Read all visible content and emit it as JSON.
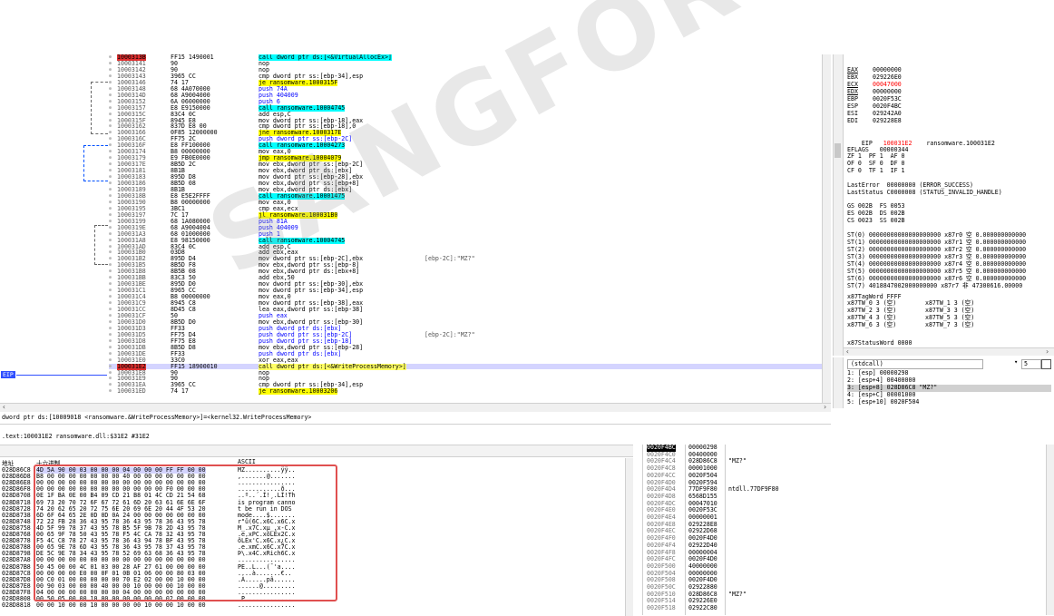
{
  "disasm": {
    "rows": [
      {
        "addr": "1000313B",
        "bytes": "FF15 1490001",
        "instr": "call dword ptr ds:[<&VirtualAllocEx>]",
        "comment": "",
        "kind": "call",
        "cur": false
      },
      {
        "addr": "10003141",
        "bytes": "90",
        "instr": "nop",
        "comment": "",
        "kind": "",
        "cur": false
      },
      {
        "addr": "10003142",
        "bytes": "90",
        "instr": "nop",
        "comment": "",
        "kind": "",
        "cur": false
      },
      {
        "addr": "10003143",
        "bytes": "3965 CC",
        "instr": "cmp dword ptr ss:[ebp-34],esp",
        "comment": "",
        "kind": "",
        "cur": false
      },
      {
        "addr": "10003146",
        "bytes": "74 17",
        "instr": "je ransomware.1000315F",
        "comment": "",
        "kind": "jmp",
        "cur": false
      },
      {
        "addr": "10003148",
        "bytes": "68 4A070000",
        "instr": "push 74A",
        "comment": "",
        "kind": "push",
        "cur": false
      },
      {
        "addr": "1000314D",
        "bytes": "68 A9004000",
        "instr": "push 404009",
        "comment": "",
        "kind": "push",
        "cur": false
      },
      {
        "addr": "10003152",
        "bytes": "6A 06000000",
        "instr": "push 6",
        "comment": "",
        "kind": "push",
        "cur": false
      },
      {
        "addr": "10003157",
        "bytes": "E8 E9150000",
        "instr": "call ransomware.10004745",
        "comment": "",
        "kind": "call",
        "cur": false
      },
      {
        "addr": "1000315C",
        "bytes": "83C4 0C",
        "instr": "add esp,C",
        "comment": "",
        "kind": "",
        "cur": false
      },
      {
        "addr": "1000315F",
        "bytes": "8945 E8",
        "instr": "mov dword ptr ss:[ebp-18],eax",
        "comment": "",
        "kind": "",
        "cur": false
      },
      {
        "addr": "10003162",
        "bytes": "837D E8 00",
        "instr": "cmp dword ptr ss:[ebp-18],0",
        "comment": "",
        "kind": "",
        "cur": false
      },
      {
        "addr": "10003166",
        "bytes": "0F85 12000000",
        "instr": "jne ransomware.1000317E",
        "comment": "",
        "kind": "jmp",
        "cur": false
      },
      {
        "addr": "1000316C",
        "bytes": "FF75 2C",
        "instr": "push dword ptr ss:[ebp-2C]",
        "comment": "",
        "kind": "push",
        "cur": false
      },
      {
        "addr": "1000316F",
        "bytes": "E8 FF100000",
        "instr": "call ransomware.10004273",
        "comment": "",
        "kind": "call",
        "cur": false
      },
      {
        "addr": "10003174",
        "bytes": "B8 00000000",
        "instr": "mov eax,0",
        "comment": "",
        "kind": "",
        "cur": false
      },
      {
        "addr": "10003179",
        "bytes": "E9 FB0E0000",
        "instr": "jmp ransomware.10004079",
        "comment": "",
        "kind": "jmp",
        "cur": false
      },
      {
        "addr": "1000317E",
        "bytes": "8B5D 2C",
        "instr": "mov ebx,dword ptr ss:[ebp-2C]",
        "comment": "",
        "kind": "",
        "cur": false
      },
      {
        "addr": "10003181",
        "bytes": "8B1B",
        "instr": "mov ebx,dword ptr ds:[ebx]",
        "comment": "",
        "kind": "",
        "cur": false
      },
      {
        "addr": "10003183",
        "bytes": "895D D8",
        "instr": "mov dword ptr ss:[ebp-28],ebx",
        "comment": "",
        "kind": "",
        "cur": false
      },
      {
        "addr": "10003186",
        "bytes": "8B5D 08",
        "instr": "mov ebx,dword ptr ss:[ebp+8]",
        "comment": "",
        "kind": "",
        "cur": false
      },
      {
        "addr": "10003189",
        "bytes": "8B1B",
        "instr": "mov ebx,dword ptr ds:[ebx]",
        "comment": "",
        "kind": "",
        "cur": false
      },
      {
        "addr": "1000318B",
        "bytes": "E8 E5E2FFFF",
        "instr": "call ransomware.10001475",
        "comment": "",
        "kind": "call",
        "cur": false
      },
      {
        "addr": "10003190",
        "bytes": "B8 00000000",
        "instr": "mov eax,0",
        "comment": "",
        "kind": "",
        "cur": false
      },
      {
        "addr": "10003195",
        "bytes": "3BC1",
        "instr": "cmp eax,ecx",
        "comment": "",
        "kind": "",
        "cur": false
      },
      {
        "addr": "10003197",
        "bytes": "7C 17",
        "instr": "jl ransomware.100031B0",
        "comment": "",
        "kind": "jmp",
        "cur": false
      },
      {
        "addr": "10003199",
        "bytes": "68 1A080000",
        "instr": "push 81A",
        "comment": "",
        "kind": "push",
        "cur": false
      },
      {
        "addr": "1000319E",
        "bytes": "68 A9004004",
        "instr": "push 404009",
        "comment": "",
        "kind": "push",
        "cur": false
      },
      {
        "addr": "100031A3",
        "bytes": "68 01000000",
        "instr": "push 1",
        "comment": "",
        "kind": "push",
        "cur": false
      },
      {
        "addr": "100031A8",
        "bytes": "E8 98150000",
        "instr": "call ransomware.10004745",
        "comment": "",
        "kind": "call",
        "cur": false
      },
      {
        "addr": "100031AD",
        "bytes": "83C4 0C",
        "instr": "add esp,C",
        "comment": "",
        "kind": "",
        "cur": false
      },
      {
        "addr": "100031B0",
        "bytes": "03D8",
        "instr": "add ebx,eax",
        "comment": "",
        "kind": "",
        "cur": false
      },
      {
        "addr": "100031B2",
        "bytes": "895D D4",
        "instr": "mov dword ptr ss:[ebp-2C],ebx",
        "comment": "[ebp-2C]:\"MZ?\"",
        "kind": "",
        "cur": false
      },
      {
        "addr": "100031B5",
        "bytes": "8B5D F8",
        "instr": "mov ebx,dword ptr ss:[ebp-8]",
        "comment": "",
        "kind": "",
        "cur": false
      },
      {
        "addr": "100031B8",
        "bytes": "8B5B 08",
        "instr": "mov ebx,dword ptr ds:[ebx+8]",
        "comment": "",
        "kind": "",
        "cur": false
      },
      {
        "addr": "100031BB",
        "bytes": "83C3 50",
        "instr": "add ebx,50",
        "comment": "",
        "kind": "",
        "cur": false
      },
      {
        "addr": "100031BE",
        "bytes": "895D D0",
        "instr": "mov dword ptr ss:[ebp-30],ebx",
        "comment": "",
        "kind": "",
        "cur": false
      },
      {
        "addr": "100031C1",
        "bytes": "8965 CC",
        "instr": "mov dword ptr ss:[ebp-34],esp",
        "comment": "",
        "kind": "",
        "cur": false
      },
      {
        "addr": "100031C4",
        "bytes": "B8 00000000",
        "instr": "mov eax,0",
        "comment": "",
        "kind": "",
        "cur": false
      },
      {
        "addr": "100031C9",
        "bytes": "8945 C8",
        "instr": "mov dword ptr ss:[ebp-38],eax",
        "comment": "",
        "kind": "",
        "cur": false
      },
      {
        "addr": "100031CC",
        "bytes": "8D45 C8",
        "instr": "lea eax,dword ptr ss:[ebp-38]",
        "comment": "",
        "kind": "",
        "cur": false
      },
      {
        "addr": "100031CF",
        "bytes": "50",
        "instr": "push eax",
        "comment": "",
        "kind": "push",
        "cur": false
      },
      {
        "addr": "100031D0",
        "bytes": "8B5D D0",
        "instr": "mov ebx,dword ptr ss:[ebp-30]",
        "comment": "",
        "kind": "",
        "cur": false
      },
      {
        "addr": "100031D3",
        "bytes": "FF33",
        "instr": "push dword ptr ds:[ebx]",
        "comment": "",
        "kind": "push",
        "cur": false
      },
      {
        "addr": "100031D5",
        "bytes": "FF75 D4",
        "instr": "push dword ptr ss:[ebp-2C]",
        "comment": "[ebp-2C]:\"MZ?\"",
        "kind": "push",
        "cur": false
      },
      {
        "addr": "100031D8",
        "bytes": "FF75 E8",
        "instr": "push dword ptr ss:[ebp-18]",
        "comment": "",
        "kind": "push",
        "cur": false
      },
      {
        "addr": "100031DB",
        "bytes": "8B5D D8",
        "instr": "mov ebx,dword ptr ss:[ebp-28]",
        "comment": "",
        "kind": "",
        "cur": false
      },
      {
        "addr": "100031DE",
        "bytes": "FF33",
        "instr": "push dword ptr ds:[ebx]",
        "comment": "",
        "kind": "push",
        "cur": false
      },
      {
        "addr": "100031E0",
        "bytes": "33C0",
        "instr": "xor eax,eax",
        "comment": "",
        "kind": "",
        "cur": false
      },
      {
        "addr": "100031E2",
        "bytes": "FF15 18900010",
        "instr": "call dword ptr ds:[<&WriteProcessMemory>]",
        "comment": "",
        "kind": "call",
        "cur": true
      },
      {
        "addr": "100031E8",
        "bytes": "90",
        "instr": "nop",
        "comment": "",
        "kind": "",
        "cur": false
      },
      {
        "addr": "100031E9",
        "bytes": "90",
        "instr": "nop",
        "comment": "",
        "kind": "",
        "cur": false
      },
      {
        "addr": "100031EA",
        "bytes": "3965 CC",
        "instr": "cmp dword ptr ss:[ebp-34],esp",
        "comment": "",
        "kind": "",
        "cur": false
      },
      {
        "addr": "100031ED",
        "bytes": "74 17",
        "instr": "je ransomware.10003206",
        "comment": "",
        "kind": "jmp",
        "cur": false
      }
    ],
    "eip_label": "EIP",
    "info_line": "dword ptr ds:[10009018 <ransomware.&WriteProcessMemory>]=<kernel32.WriteProcessMemory>",
    "section_line": ".text:100031E2 ransomware.dll:$31E2 #31E2"
  },
  "registers": {
    "general": [
      {
        "name": "EAX",
        "value": "00000000",
        "changed": false
      },
      {
        "name": "EBX",
        "value": "029226E0",
        "changed": false
      },
      {
        "name": "ECX",
        "value": "00047000",
        "changed": true
      },
      {
        "name": "EDX",
        "value": "00000000",
        "changed": false
      },
      {
        "name": "EBP",
        "value": "0020F53C",
        "changed": false
      },
      {
        "name": "ESP",
        "value": "0020F4BC",
        "changed": false
      },
      {
        "name": "ESI",
        "value": "029242A0",
        "changed": false
      },
      {
        "name": "EDI",
        "value": "029228E8",
        "changed": false
      }
    ],
    "eip_name": "EIP",
    "eip_value": "100031E2",
    "eip_comment": "ransomware.100031E2",
    "eflags": "EFLAGS   00000344",
    "flags_lines": [
      "ZF 1  PF 1  AF 0",
      "OF 0  SF 0  DF 0",
      "CF 0  TF 1  IF 1"
    ],
    "last_error": "LastError  00000000 (ERROR_SUCCESS)",
    "last_status": "LastStatus C0000008 (STATUS_INVALID_HANDLE)",
    "segs": [
      "GS 002B  FS 0053",
      "ES 002B  DS 002B",
      "CS 0023  SS 002B"
    ],
    "st": [
      "ST(0) 00000000000000000000 x87r0 空 0.000000000000",
      "ST(1) 00000000000000000000 x87r1 空 0.000000000000",
      "ST(2) 00000000000000000000 x87r2 空 0.000000000000",
      "ST(3) 00000000000000000000 x87r3 空 0.000000000000",
      "ST(4) 00000000000000000000 x87r4 空 0.000000000000",
      "ST(5) 00000000000000000000 x87r5 空 0.000000000000",
      "ST(6) 00000000000000000000 x87r6 空 0.000000000000",
      "ST(7) 4018847002000000000 x87r7 非 47300616.00000"
    ],
    "tagword": "x87TagWord FFFF",
    "tw": [
      "x87TW_0 3 (空)        x87TW_1 3 (空)",
      "x87TW_2 3 (空)        x87TW_3 3 (空)",
      "x87TW_4 3 (空)        x87TW_5 3 (空)",
      "x87TW_6 3 (空)        x87TW_7 3 (空)"
    ],
    "statusword": "x87StatusWord 0000"
  },
  "callconv": {
    "select": "(stdcall)",
    "count": "5",
    "args": [
      "1: [esp] 00000298",
      "2: [esp+4] 00400000",
      "3: [esp+8] 028D86C8 \"MZ?\"",
      "4: [esp+C] 00001000",
      "5: [esp+10] 0020F504"
    ]
  },
  "dump": {
    "col_addr": "地址",
    "col_hex": "十六进制",
    "col_ascii": "ASCII",
    "rows": [
      {
        "addr": "028D86C8",
        "hex": "4D 5A 90 00 03 00 00 00 04 00 00 00 FF FF 00 00",
        "ascii": "MZ..........ÿÿ.."
      },
      {
        "addr": "028D86D8",
        "hex": "B8 00 00 00 00 00 00 00 40 00 00 00 00 00 00 00",
        "ascii": ",.......@......."
      },
      {
        "addr": "028D86E8",
        "hex": "00 00 00 00 00 00 00 00 00 00 00 00 00 00 00 00",
        "ascii": "................"
      },
      {
        "addr": "028D86F8",
        "hex": "00 00 00 00 00 00 00 00 00 00 00 00 F0 00 00 00",
        "ascii": "............ð..."
      },
      {
        "addr": "028D8708",
        "hex": "0E 1F BA 0E 00 B4 09 CD 21 B8 01 4C CD 21 54 68",
        "ascii": "..º..´.Í!¸.LÍ!Th"
      },
      {
        "addr": "028D8718",
        "hex": "69 73 20 70 72 6F 67 72 61 6D 20 63 61 6E 6E 6F",
        "ascii": "is program canno"
      },
      {
        "addr": "028D8728",
        "hex": "74 20 62 65 20 72 75 6E 20 69 6E 20 44 4F 53 20",
        "ascii": "t be run in DOS "
      },
      {
        "addr": "028D8738",
        "hex": "6D 6F 64 65 2E 0D 0D 0A 24 00 00 00 00 00 00 00",
        "ascii": "mode....$......."
      },
      {
        "addr": "028D8748",
        "hex": "72 22 FB 28 36 43 95 78 36 43 95 78 36 43 95 78",
        "ascii": "r\"û(6C.x6C.x6C.x"
      },
      {
        "addr": "028D8758",
        "hex": "4D 5F 99 78 37 43 95 78 B5 5F 9B 78 2D 43 95 78",
        "ascii": "M_.x7C.xµ_.x-C.x"
      },
      {
        "addr": "028D8768",
        "hex": "00 65 9F 78 50 43 95 78 F5 4C CA 78 32 43 95 78",
        "ascii": ".e.xPC.xõLÊx2C.x"
      },
      {
        "addr": "028D8778",
        "hex": "F5 4C C8 78 27 43 95 78 36 43 94 78 BF 43 95 78",
        "ascii": "õLÈx'C.x6C.x¿C.x"
      },
      {
        "addr": "028D8788",
        "hex": "00 65 9E 78 6D 43 95 78 36 43 95 78 37 43 95 78",
        "ascii": ".e.xmC.x6C.x7C.x"
      },
      {
        "addr": "028D8798",
        "hex": "DE 5C 9E 78 34 43 95 78 52 69 63 68 36 43 95 78",
        "ascii": "Þ\\.x4C.xRich6C.x"
      },
      {
        "addr": "028D87A8",
        "hex": "00 00 00 00 00 00 00 00 00 00 00 00 00 00 00 00",
        "ascii": "................"
      },
      {
        "addr": "028D87B8",
        "hex": "50 45 00 00 4C 01 03 00 28 AF 27 61 00 00 00 00",
        "ascii": "PE..L...(¯'a...."
      },
      {
        "addr": "028D87C8",
        "hex": "00 00 00 00 E0 00 0F 01 0B 01 06 00 00 80 03 00",
        "ascii": "....à.......€.."
      },
      {
        "addr": "028D87D8",
        "hex": "00 C0 01 00 00 00 00 00 70 E2 02 00 00 10 00 00",
        "ascii": ".À......pâ......"
      },
      {
        "addr": "028D87E8",
        "hex": "00 90 03 00 00 00 40 00 00 10 00 00 00 10 00 00",
        "ascii": "......@........."
      },
      {
        "addr": "028D87F8",
        "hex": "04 00 00 00 00 00 00 00 04 00 00 00 00 00 00 00",
        "ascii": "................"
      },
      {
        "addr": "028D8808",
        "hex": "00 50 05 00 00 10 00 00 00 00 00 00 02 00 00 00",
        "ascii": ".P.............."
      },
      {
        "addr": "028D8818",
        "hex": "00 00 10 00 00 10 00 00 00 00 10 00 00 10 00 00",
        "ascii": "................"
      }
    ]
  },
  "stack": {
    "rows": [
      {
        "addr": "0020F4BC",
        "val": "00000298",
        "comment": "",
        "cur": true
      },
      {
        "addr": "0020F4C0",
        "val": "00400000",
        "comment": "",
        "cur": false
      },
      {
        "addr": "0020F4C4",
        "val": "028D86C8",
        "comment": "\"MZ?\"",
        "cur": false
      },
      {
        "addr": "0020F4C8",
        "val": "00001000",
        "comment": "",
        "cur": false
      },
      {
        "addr": "0020F4CC",
        "val": "0020F504",
        "comment": "",
        "cur": false
      },
      {
        "addr": "0020F4D0",
        "val": "0020F594",
        "comment": "",
        "cur": false
      },
      {
        "addr": "0020F4D4",
        "val": "77DF9F80",
        "comment": "ntdll.77DF9F80",
        "cur": false
      },
      {
        "addr": "0020F4D8",
        "val": "6568D155",
        "comment": "",
        "cur": false
      },
      {
        "addr": "0020F4DC",
        "val": "00047010",
        "comment": "",
        "cur": false
      },
      {
        "addr": "0020F4E0",
        "val": "0020F53C",
        "comment": "",
        "cur": false
      },
      {
        "addr": "0020F4E4",
        "val": "00000001",
        "comment": "",
        "cur": false
      },
      {
        "addr": "0020F4E8",
        "val": "029228E8",
        "comment": "",
        "cur": false
      },
      {
        "addr": "0020F4EC",
        "val": "02922D68",
        "comment": "",
        "cur": false
      },
      {
        "addr": "0020F4F0",
        "val": "0020F4D0",
        "comment": "",
        "cur": false
      },
      {
        "addr": "0020F4F4",
        "val": "02922D40",
        "comment": "",
        "cur": false
      },
      {
        "addr": "0020F4F8",
        "val": "00000004",
        "comment": "",
        "cur": false
      },
      {
        "addr": "0020F4FC",
        "val": "0020F4D0",
        "comment": "",
        "cur": false
      },
      {
        "addr": "0020F500",
        "val": "40000000",
        "comment": "",
        "cur": false
      },
      {
        "addr": "0020F504",
        "val": "00000000",
        "comment": "",
        "cur": false
      },
      {
        "addr": "0020F508",
        "val": "0020F4D0",
        "comment": "",
        "cur": false
      },
      {
        "addr": "0020F50C",
        "val": "02922880",
        "comment": "",
        "cur": false
      },
      {
        "addr": "0020F510",
        "val": "028D86C8",
        "comment": "\"MZ?\"",
        "cur": false
      },
      {
        "addr": "0020F514",
        "val": "029226E0",
        "comment": "",
        "cur": false
      },
      {
        "addr": "0020F518",
        "val": "02922C80",
        "comment": "",
        "cur": false
      }
    ]
  },
  "watermark": "SANGFOR",
  "colors": {
    "selected_row": "#d4d4ff",
    "call_highlight": "#00ffff",
    "jump_highlight": "#ffff00",
    "eip_arrow": "#3050ff",
    "changed_reg": "#ff0000",
    "red_box": "#e05050"
  }
}
